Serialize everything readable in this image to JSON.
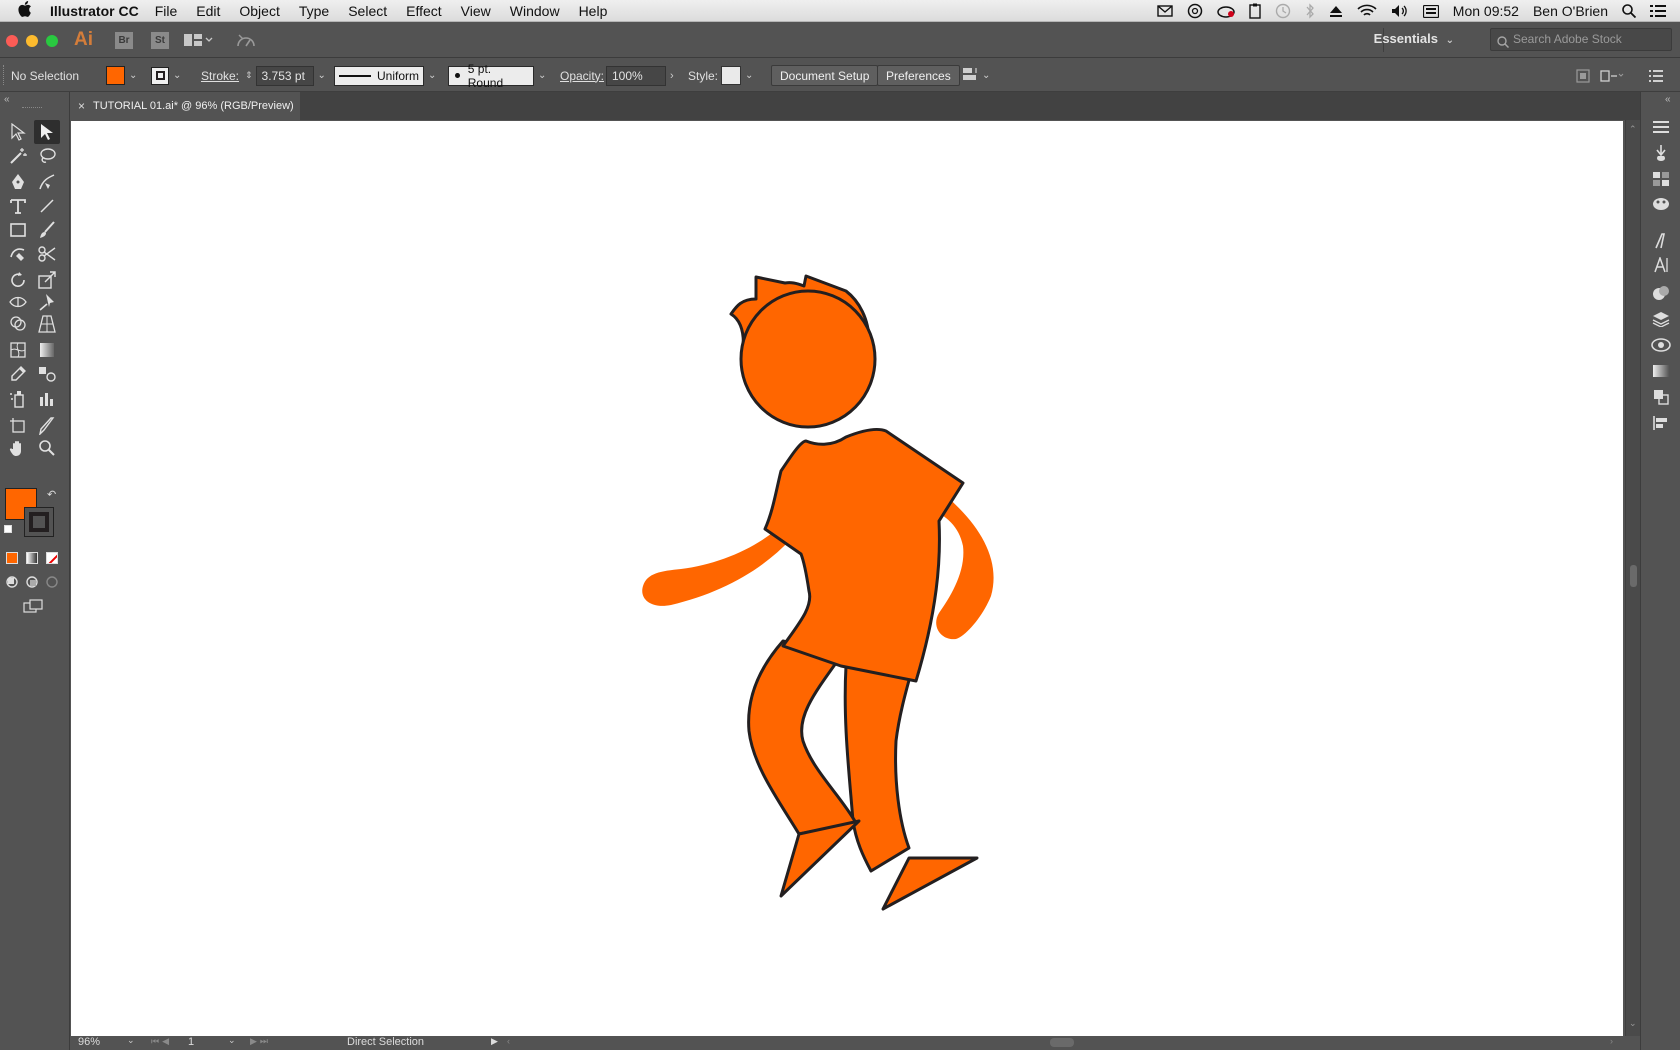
{
  "menubar": {
    "app_name": "Illustrator CC",
    "items": [
      "File",
      "Edit",
      "Object",
      "Type",
      "Select",
      "Effect",
      "View",
      "Window",
      "Help"
    ],
    "clock": "Mon 09:52",
    "user": "Ben O'Brien"
  },
  "appbar": {
    "logo": "Ai",
    "bridge": "Br",
    "stock": "St",
    "workspace": "Essentials",
    "search_placeholder": "Search Adobe Stock"
  },
  "control": {
    "selection": "No Selection",
    "stroke_label": "Stroke:",
    "stroke_value": "3.753 pt",
    "profile": "Uniform",
    "brush": "5 pt. Round",
    "opacity_label": "Opacity:",
    "opacity_value": "100%",
    "style_label": "Style:",
    "document_setup": "Document Setup",
    "preferences": "Preferences"
  },
  "document": {
    "tab_title": "TUTORIAL 01.ai* @ 96% (RGB/Preview)"
  },
  "colors": {
    "fill": "#ff6600",
    "stroke": "#231f20",
    "ui_bg": "#535353"
  },
  "statusbar": {
    "zoom": "96%",
    "page": "1",
    "tool": "Direct Selection"
  }
}
